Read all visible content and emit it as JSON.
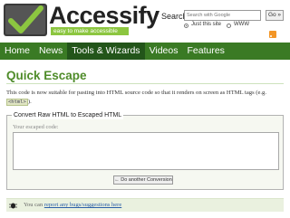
{
  "header": {
    "logo_title": "Accessify",
    "logo_tagline": "easy to make accessible",
    "search_label": "Search",
    "search_placeholder": "Search with Google",
    "go_label": "Go »",
    "scope_options": [
      {
        "label": "Just this site",
        "selected": true
      },
      {
        "label": "WWW",
        "selected": false
      }
    ]
  },
  "nav": {
    "items": [
      {
        "label": "Home",
        "active": false
      },
      {
        "label": "News",
        "active": false
      },
      {
        "label": "Tools & Wizards",
        "active": true
      },
      {
        "label": "Videos",
        "active": false
      },
      {
        "label": "Features",
        "active": false
      }
    ]
  },
  "main": {
    "title": "Quick Escape",
    "intro_before": "This code is now suitable for pasting into HTML source code so that it renders on screen as HTML tags (e.g. ",
    "intro_code": "<html>",
    "intro_after": ").",
    "fieldset_legend": "Convert Raw HTML to Escaped HTML",
    "escaped_label": "Your escaped code:",
    "escaped_value": "",
    "convert_button_label": "← Do another Conversion"
  },
  "footer": {
    "prefix": "You can ",
    "link_text": "report any bugs/suggestions here"
  },
  "colors": {
    "brand_green": "#8cc640",
    "nav_bg": "#3a7a24",
    "nav_active_bg": "#23551a",
    "title_green": "#4f8c2a",
    "link_blue": "#2b5fa8"
  }
}
